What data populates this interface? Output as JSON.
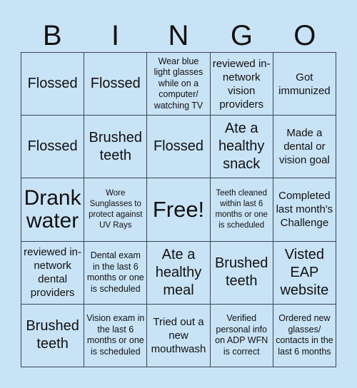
{
  "header": {
    "letters": [
      "B",
      "I",
      "N",
      "G",
      "O"
    ]
  },
  "colors": {
    "background": "#c9e3f6",
    "cell_background": "#c9e3f6",
    "border": "#3a4450",
    "text": "#111111"
  },
  "board": {
    "rows": [
      [
        "Flossed",
        "Flossed",
        "Wear blue light glasses while on a computer/ watching TV",
        "reviewed in-network vision providers",
        "Got immunized"
      ],
      [
        "Flossed",
        "Brushed teeth",
        "Flossed",
        "Ate a healthy snack",
        "Made a dental or vision goal"
      ],
      [
        "Drank water",
        "Wore Sunglasses to protect against UV Rays",
        "Free!",
        "Teeth cleaned within last 6 months or one is scheduled",
        "Completed last month's Challenge"
      ],
      [
        "reviewed in-network dental providers",
        "Dental exam in the last 6 months or one is scheduled",
        "Ate a healthy meal",
        "Brushed teeth",
        "Visted EAP website"
      ],
      [
        "Brushed teeth",
        "Vision exam in the last 6 months or one is scheduled",
        "Tried out a new mouthwash",
        "Verified personal info on ADP WFN is correct",
        "Ordered new glasses/ contacts in the last 6 months"
      ]
    ]
  }
}
